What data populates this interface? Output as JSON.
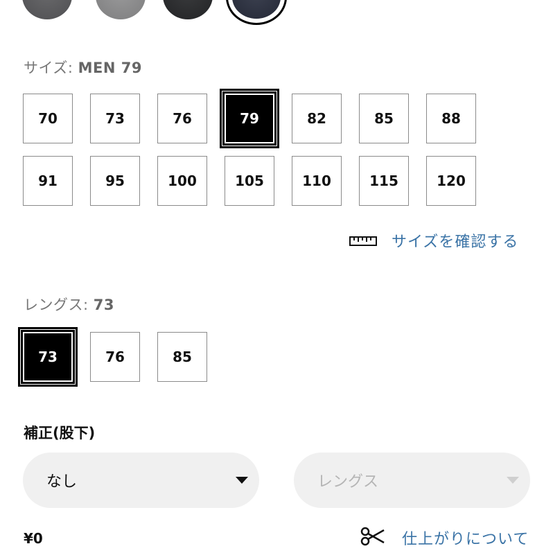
{
  "colors": {
    "swatches": [
      "dark-gray",
      "gray",
      "charcoal",
      "navy"
    ],
    "selected_swatch": "navy"
  },
  "size": {
    "label_prefix": "サイズ:",
    "label_value": "MEN 79",
    "row1": [
      "70",
      "73",
      "76",
      "79",
      "82",
      "85",
      "88"
    ],
    "row2": [
      "91",
      "95",
      "100",
      "105",
      "110",
      "115",
      "120"
    ],
    "selected": "79",
    "check_link": "サイズを確認する"
  },
  "length": {
    "label_prefix": "レングス:",
    "label_value": "73",
    "options": [
      "73",
      "76",
      "85"
    ],
    "selected": "73"
  },
  "alteration": {
    "heading": "補正(股下)",
    "select_value": "なし",
    "length_placeholder": "レングス",
    "price": "¥0",
    "about_link": "仕上がりについて"
  },
  "icons": {
    "ruler": "ruler-icon",
    "scissors": "scissors-icon",
    "caret": "caret-down-icon"
  },
  "accent_color": "#3a73a6"
}
